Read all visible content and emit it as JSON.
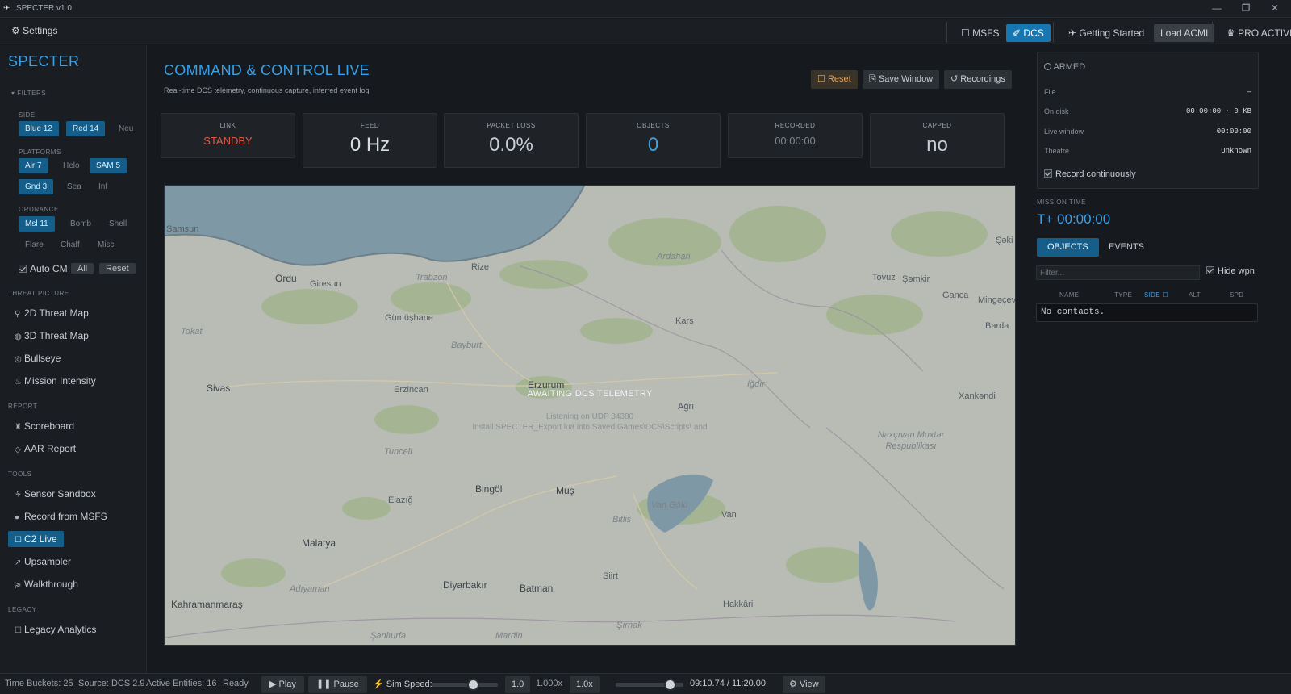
{
  "window": {
    "title": "SPECTER v1.0",
    "controls": [
      "—",
      "❐",
      "✕"
    ]
  },
  "topbar": {
    "settings_label": "Settings",
    "msfs_label": "MSFS",
    "dcs_label": "DCS",
    "getting_started_label": "Getting Started",
    "load_acmi_label": "Load ACMI",
    "pro_active_label": "PRO ACTIVE"
  },
  "sidebar": {
    "brand": "SPECTER",
    "filters_heading": "FILTERS",
    "side_heading": "SIDE",
    "side_chips": [
      {
        "label": "Blue  12",
        "on": true
      },
      {
        "label": "Red  14",
        "on": true
      },
      {
        "label": "Neu",
        "on": false
      }
    ],
    "platforms_heading": "PLATFORMS",
    "platform_chips": [
      {
        "label": "Air  7",
        "on": true
      },
      {
        "label": "Helo",
        "on": false
      },
      {
        "label": "SAM  5",
        "on": true
      },
      {
        "label": "Gnd  3",
        "on": true
      },
      {
        "label": "Sea",
        "on": false
      },
      {
        "label": "Inf",
        "on": false
      }
    ],
    "ordnance_heading": "ORDNANCE",
    "ordnance_chips": [
      {
        "label": "Msl  11",
        "on": true
      },
      {
        "label": "Bomb",
        "on": false
      },
      {
        "label": "Shell",
        "on": false
      },
      {
        "label": "Flare",
        "on": false
      },
      {
        "label": "Chaff",
        "on": false
      },
      {
        "label": "Misc",
        "on": false
      }
    ],
    "auto_cm_label": "Auto CM",
    "all_label": "All",
    "reset_label": "Reset",
    "threat_heading": "THREAT PICTURE",
    "threat_items": [
      "2D Threat Map",
      "3D Threat Map",
      "Bullseye",
      "Mission Intensity"
    ],
    "report_heading": "REPORT",
    "report_items": [
      "Scoreboard",
      "AAR Report"
    ],
    "tools_heading": "TOOLS",
    "tools_items": [
      "Sensor Sandbox",
      "Record from MSFS",
      "C2 Live",
      "Upsampler",
      "Walkthrough"
    ],
    "legacy_heading": "LEGACY",
    "legacy_items": [
      "Legacy Analytics"
    ]
  },
  "main": {
    "title": "COMMAND & CONTROL LIVE",
    "subtitle": "Real-time DCS telemetry, continuous capture, inferred event log",
    "reset_label": "Reset",
    "save_window_label": "Save Window",
    "recordings_label": "Recordings",
    "stats": [
      {
        "label": "LINK",
        "value": "STANDBY",
        "color": "#e05a4a"
      },
      {
        "label": "FEED",
        "value": "0 Hz",
        "color": "#d8dde2"
      },
      {
        "label": "PACKET LOSS",
        "value": "0.0%",
        "color": "#c9ced4"
      },
      {
        "label": "OBJECTS",
        "value": "0",
        "color": "#3aa0e6"
      },
      {
        "label": "RECORDED",
        "value": "00:00:00",
        "color": "#7d848b"
      },
      {
        "label": "CAPPED",
        "value": "no",
        "color": "#c9ced4"
      }
    ],
    "map": {
      "awaiting": "AWAITING DCS TELEMETRY",
      "listening": "Listening on UDP 34380",
      "install_hint": "Install SPECTER_Export.lua into Saved Games\\DCS\\Scripts\\ and",
      "labels": [
        "Ordu",
        "Giresun",
        "Rize",
        "Trabzon",
        "Gümüşhane",
        "Bayburt",
        "Erzurum",
        "Erzincan",
        "Sivas",
        "Tokat",
        "Ardahan",
        "Kars",
        "Iğdır",
        "Ağrı",
        "Muş",
        "Bingöl",
        "Elazığ",
        "Tunceli",
        "Malatya",
        "Diyarbakır",
        "Batman",
        "Siirt",
        "Bitlis",
        "Van",
        "Hakkâri",
        "Şırnak",
        "Mardin",
        "Şanlıurfa",
        "Adıyaman",
        "Kahramanmaraş",
        "Van Gölü",
        "Tovuz",
        "Şəmkir",
        "Ganca",
        "Mingəçevir",
        "Barda",
        "Xankəndi",
        "Naxçıvan Muxtar Respublikası",
        "Şəki",
        "Samsun"
      ]
    }
  },
  "right": {
    "armed_label": "ARMED",
    "file_label": "File",
    "file_value": "—",
    "on_disk_label": "On disk",
    "on_disk_value": "00:00:00  ·  0 KB",
    "live_window_label": "Live window",
    "live_window_value": "00:00:00",
    "theatre_label": "Theatre",
    "theatre_value": "Unknown",
    "record_continuously_label": "Record continuously",
    "mission_time_label": "MISSION TIME",
    "mission_time_value": "T+ 00:00:00",
    "tab_objects": "OBJECTS",
    "tab_events": "EVENTS",
    "filter_placeholder": "Filter...",
    "hide_wpn_label": "Hide wpn",
    "columns": [
      "NAME",
      "TYPE",
      "SIDE ☐",
      "ALT",
      "SPD"
    ],
    "no_contacts": "No contacts."
  },
  "statusbar": {
    "time_buckets": "Time Buckets: 25",
    "source": "Source: DCS 2.9",
    "active_entities": "Active Entities: 16",
    "ready": "Ready",
    "play_label": "Play",
    "pause_label": "Pause",
    "sim_speed_label": "Sim Speed:",
    "speed_value": "1.0",
    "speed_multiplier": "1.000x",
    "speed_reset": "1.0x",
    "timecode": "09:10.74 / 11:20.00",
    "view_label": "View",
    "sim_speed_fraction": 0.62,
    "timeline_fraction": 0.8
  }
}
